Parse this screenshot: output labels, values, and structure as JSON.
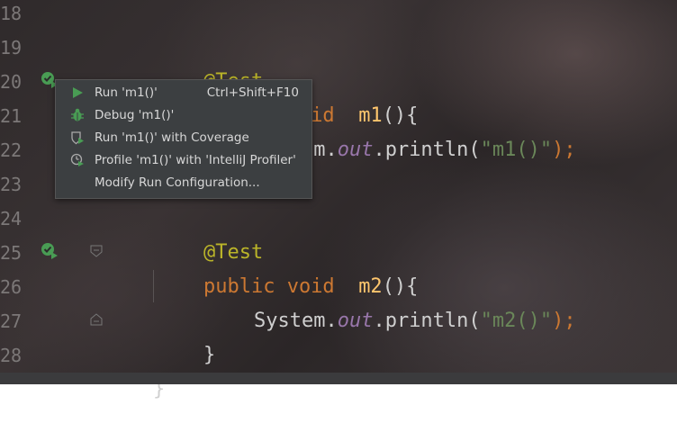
{
  "gutter": {
    "line_numbers": [
      "18",
      "19",
      "20",
      "21",
      "22",
      "23",
      "24",
      "25",
      "26",
      "27",
      "28"
    ]
  },
  "code": {
    "annotation_1": "@Test",
    "line20_keyword": "public void",
    "line20_method": "m1",
    "line20_rest": "(){",
    "line21_prefix": "System.",
    "line21_field": "out",
    "line21_call": ".println(",
    "line21_string": "\"m1()\"",
    "line21_end": ");",
    "annotation_2": "@Test",
    "line25_keyword": "public void",
    "line25_method": "m2",
    "line25_rest": "(){",
    "line26_prefix": "System.",
    "line26_field": "out",
    "line26_call": ".println(",
    "line26_string": "\"m2()\"",
    "line26_end": ");",
    "line27_brace": "}",
    "line28_brace": "}"
  },
  "popup": {
    "items": [
      {
        "label": "Run 'm1()'",
        "shortcut": "Ctrl+Shift+F10",
        "icon": "run-icon"
      },
      {
        "label": "Debug 'm1()'",
        "shortcut": "",
        "icon": "debug-icon"
      },
      {
        "label": "Run 'm1()' with Coverage",
        "shortcut": "",
        "icon": "coverage-icon"
      },
      {
        "label": "Profile 'm1()' with 'IntelliJ Profiler'",
        "shortcut": "",
        "icon": "profile-icon"
      },
      {
        "label": "Modify Run Configuration...",
        "shortcut": "",
        "icon": ""
      }
    ]
  },
  "colors": {
    "keyword": "#cc7832",
    "annotation": "#bbb529",
    "method": "#ffc66d",
    "field": "#9876aa",
    "string": "#6a8759",
    "run_green": "#499c54"
  }
}
